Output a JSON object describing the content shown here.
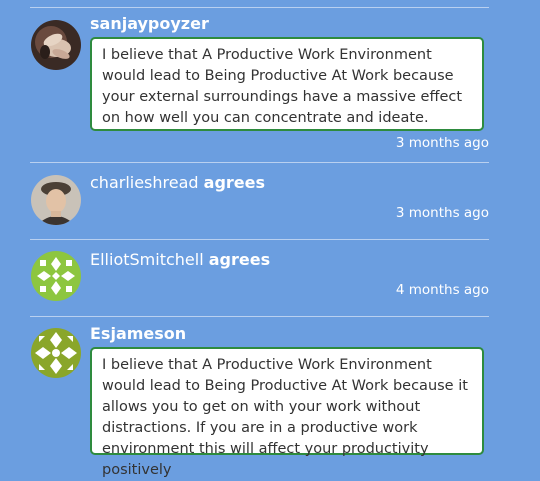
{
  "feed": {
    "items": [
      {
        "username": "sanjaypoyzer",
        "text": "I believe that A Productive Work Environment would lead to Being Productive At Work because your external surroundings have a massive effect on how well you can concentrate and ideate.",
        "time": "3 months ago"
      },
      {
        "username": "charlieshread",
        "action": "agrees",
        "time": "3 months ago"
      },
      {
        "username": "ElliotSmitchell",
        "action": "agrees",
        "time": "4 months ago"
      },
      {
        "username": "Esjameson",
        "text": "I believe that A Productive Work Environment would lead to Being Productive At Work because it allows you to get on with your work without distractions. If you are in a productive work environment this will affect your productivity positively"
      }
    ]
  },
  "colors": {
    "background": "#6b9ee0",
    "bubble_border": "#2e8b3e",
    "divider": "#b9d0f0",
    "text": "#ffffff"
  }
}
